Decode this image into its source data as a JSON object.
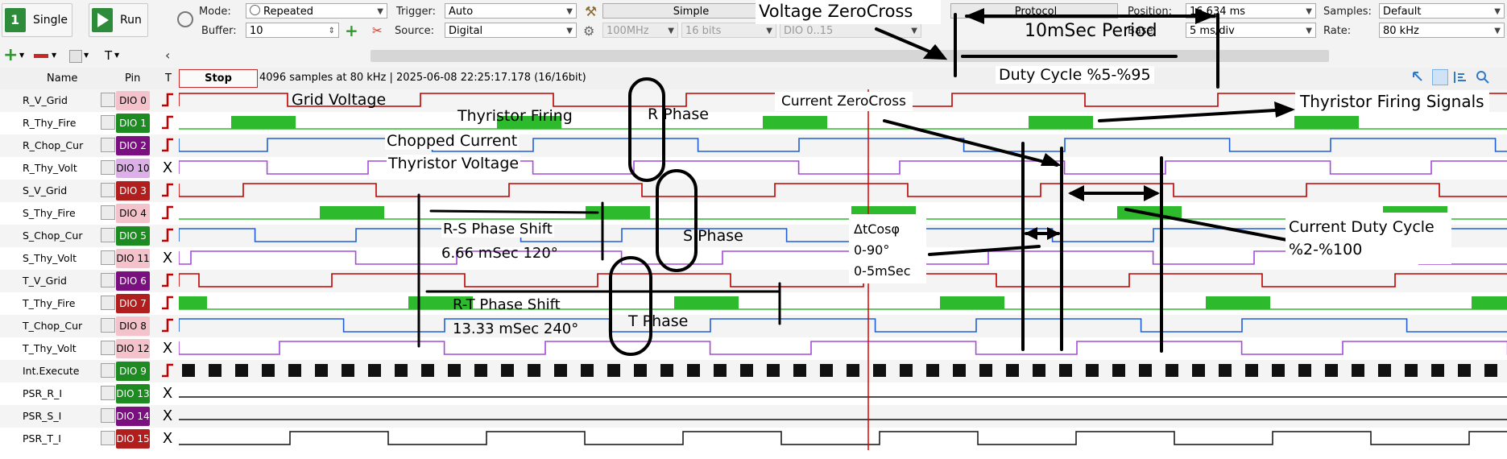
{
  "toolbar": {
    "single_label": "Single",
    "run_label": "Run",
    "mode_label": "Mode:",
    "mode_value": "Repeated",
    "buffer_label": "Buffer:",
    "buffer_value": "10",
    "trigger_label": "Trigger:",
    "trigger_value": "Auto",
    "source_label": "Source:",
    "source_value": "Digital",
    "simple_label": "Simple",
    "rate_disabled": "100MHz",
    "bits_disabled": "16 bits",
    "dio_disabled": "DIO 0..15",
    "protocol_label": "Protocol",
    "position_label": "Position:",
    "position_value": "16.634 ms",
    "base_label": "Base:",
    "base_value": "5 ms/div",
    "samples_label": "Samples:",
    "samples_value": "Default",
    "rate_label": "Rate:",
    "rate_value": "80 kHz"
  },
  "header": {
    "name_col": "Name",
    "pin_col": "Pin",
    "t_col": "T",
    "stop_label": "Stop",
    "status_text": "4096 samples at 80 kHz | 2025-06-08 22:25:17.178 (16/16bit)"
  },
  "channels": [
    {
      "name": "R_V_Grid",
      "pin": "DIO 0",
      "pin_color": "#f4c2cb",
      "pin_text": "#000000",
      "trigger": "edge"
    },
    {
      "name": "R_Thy_Fire",
      "pin": "DIO 1",
      "pin_color": "#1e8a22",
      "pin_text": "#ffffff",
      "trigger": "edge"
    },
    {
      "name": "R_Chop_Cur",
      "pin": "DIO 2",
      "pin_color": "#7a0f80",
      "pin_text": "#ffffff",
      "trigger": "edge"
    },
    {
      "name": "R_Thy_Volt",
      "pin": "DIO 10",
      "pin_color": "#dcb0e6",
      "pin_text": "#000000",
      "trigger": "X"
    },
    {
      "name": "S_V_Grid",
      "pin": "DIO 3",
      "pin_color": "#b01e1e",
      "pin_text": "#ffffff",
      "trigger": "edge"
    },
    {
      "name": "S_Thy_Fire",
      "pin": "DIO 4",
      "pin_color": "#f4c2cb",
      "pin_text": "#000000",
      "trigger": "edge"
    },
    {
      "name": "S_Chop_Cur",
      "pin": "DIO 5",
      "pin_color": "#1e8a22",
      "pin_text": "#ffffff",
      "trigger": "edge"
    },
    {
      "name": "S_Thy_Volt",
      "pin": "DIO 11",
      "pin_color": "#f4c2cb",
      "pin_text": "#000000",
      "trigger": "X"
    },
    {
      "name": "T_V_Grid",
      "pin": "DIO 6",
      "pin_color": "#7a0f80",
      "pin_text": "#ffffff",
      "trigger": "edge"
    },
    {
      "name": "T_Thy_Fire",
      "pin": "DIO 7",
      "pin_color": "#b01e1e",
      "pin_text": "#ffffff",
      "trigger": "edge"
    },
    {
      "name": "T_Chop_Cur",
      "pin": "DIO 8",
      "pin_color": "#f4c2cb",
      "pin_text": "#000000",
      "trigger": "edge"
    },
    {
      "name": "T_Thy_Volt",
      "pin": "DIO 12",
      "pin_color": "#f4c2cb",
      "pin_text": "#000000",
      "trigger": "X"
    },
    {
      "name": "Int.Execute",
      "pin": "DIO 9",
      "pin_color": "#1e8a22",
      "pin_text": "#ffffff",
      "trigger": "edge"
    },
    {
      "name": "PSR_R_I",
      "pin": "DIO 13",
      "pin_color": "#1e8a22",
      "pin_text": "#ffffff",
      "trigger": "X"
    },
    {
      "name": "PSR_S_I",
      "pin": "DIO 14",
      "pin_color": "#7a0f80",
      "pin_text": "#ffffff",
      "trigger": "X"
    },
    {
      "name": "PSR_T_I",
      "pin": "DIO 15",
      "pin_color": "#b01e1e",
      "pin_text": "#ffffff",
      "trigger": "X"
    }
  ],
  "annotations": {
    "voltage_zerocross": "Voltage ZeroCross",
    "period": "10mSec Period",
    "duty_cycle": "Duty Cycle %5-%95",
    "grid_voltage": "Grid Voltage",
    "thyristor_firing": "Thyristor Firing",
    "r_phase": "R Phase",
    "current_zerocross": "Current ZeroCross",
    "thyristor_firing_signals": "Thyristor Firing Signals",
    "chopped_current": "Chopped Current",
    "thyristor_voltage": "Thyristor Voltage",
    "rs_shift_1": "R-S Phase Shift",
    "rs_shift_2": "6.66 mSec 120°",
    "s_phase": "S Phase",
    "dcos_1": "ΔtCosφ",
    "dcos_2": "0-90°",
    "dcos_3": "0-5mSec",
    "current_duty_1": "Current Duty Cycle",
    "current_duty_2": "%2-%100",
    "rt_shift_1": "R-T Phase Shift",
    "rt_shift_2": "13.33 mSec 240°",
    "t_phase": "T Phase"
  },
  "colors": {
    "grid_signal": "#c00000",
    "fire_signal": "#2dbb2d",
    "current_signal": "#1f5fd6",
    "thyvolt_signal": "#a64ad6",
    "cursor": "#e00000"
  }
}
